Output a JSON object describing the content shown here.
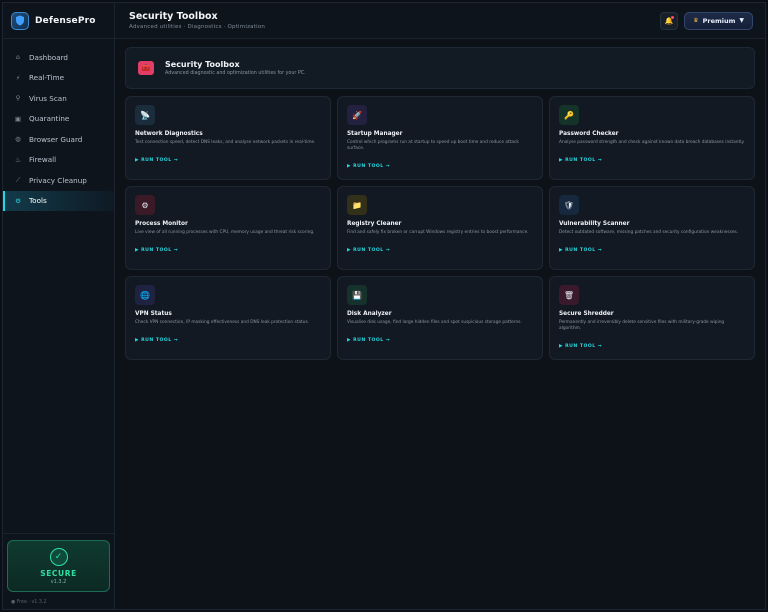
{
  "brand": {
    "name": "DefensePro"
  },
  "nav": [
    {
      "label": "Dashboard",
      "icon": "house-icon",
      "glyph": "⌂",
      "active": false
    },
    {
      "label": "Real-Time",
      "icon": "bolt-icon",
      "glyph": "⚡",
      "active": false
    },
    {
      "label": "Virus Scan",
      "icon": "magnifier-icon",
      "glyph": "⚲",
      "active": false
    },
    {
      "label": "Quarantine",
      "icon": "lock-icon",
      "glyph": "▣",
      "active": false
    },
    {
      "label": "Browser Guard",
      "icon": "globe-icon",
      "glyph": "◍",
      "active": false
    },
    {
      "label": "Firewall",
      "icon": "fire-icon",
      "glyph": "♨",
      "active": false
    },
    {
      "label": "Privacy Cleanup",
      "icon": "broom-icon",
      "glyph": "⟋",
      "active": false
    },
    {
      "label": "Tools",
      "icon": "gear-icon",
      "glyph": "⚙",
      "active": true
    }
  ],
  "status": {
    "label": "SECURE",
    "version": "v1.3.2"
  },
  "footer": {
    "text": "● Free · v1.3.2"
  },
  "header": {
    "title": "Security Toolbox",
    "subtitle": "Advanced utilities · Diagnostics · Optimization",
    "premium_label": "Premium"
  },
  "hero": {
    "title": "Security Toolbox",
    "subtitle": "Advanced diagnostic and optimization utilities for your PC."
  },
  "run_label": "▶ RUN TOOL →",
  "tools": [
    {
      "name": "Network Diagnostics",
      "desc": "Test connection speed, detect DNS leaks, and analyse network packets in real-time.",
      "icon": "antenna-icon",
      "glyph": "📡",
      "bg": "#1b2c3d"
    },
    {
      "name": "Startup Manager",
      "desc": "Control which programs run at startup to speed up boot time and reduce attack surface.",
      "icon": "rocket-icon",
      "glyph": "🚀",
      "bg": "#24203f"
    },
    {
      "name": "Password Checker",
      "desc": "Analyse password strength and check against known data breach databases instantly.",
      "icon": "key-icon",
      "glyph": "🔑",
      "bg": "#163329"
    },
    {
      "name": "Process Monitor",
      "desc": "Live view of all running processes with CPU, memory usage and threat risk scoring.",
      "icon": "cog-icon",
      "glyph": "⚙",
      "bg": "#3a1a26"
    },
    {
      "name": "Registry Cleaner",
      "desc": "Find and safely fix broken or corrupt Windows registry entries to boost performance.",
      "icon": "folder-icon",
      "glyph": "📁",
      "bg": "#33301a"
    },
    {
      "name": "Vulnerability Scanner",
      "desc": "Detect outdated software, missing patches and security configuration weaknesses.",
      "icon": "shield-icon",
      "glyph": "🛡",
      "bg": "#16283d"
    },
    {
      "name": "VPN Status",
      "desc": "Check VPN connection, IP masking effectiveness and DNS leak protection status.",
      "icon": "globe-icon",
      "glyph": "🌐",
      "bg": "#1f2341"
    },
    {
      "name": "Disk Analyzer",
      "desc": "Visualise disk usage, find large hidden files and spot suspicious storage patterns.",
      "icon": "disk-icon",
      "glyph": "💾",
      "bg": "#15332c"
    },
    {
      "name": "Secure Shredder",
      "desc": "Permanently and irreversibly delete sensitive files with military-grade wiping algorithm.",
      "icon": "trash-icon",
      "glyph": "🗑",
      "bg": "#3a1a2a"
    }
  ]
}
